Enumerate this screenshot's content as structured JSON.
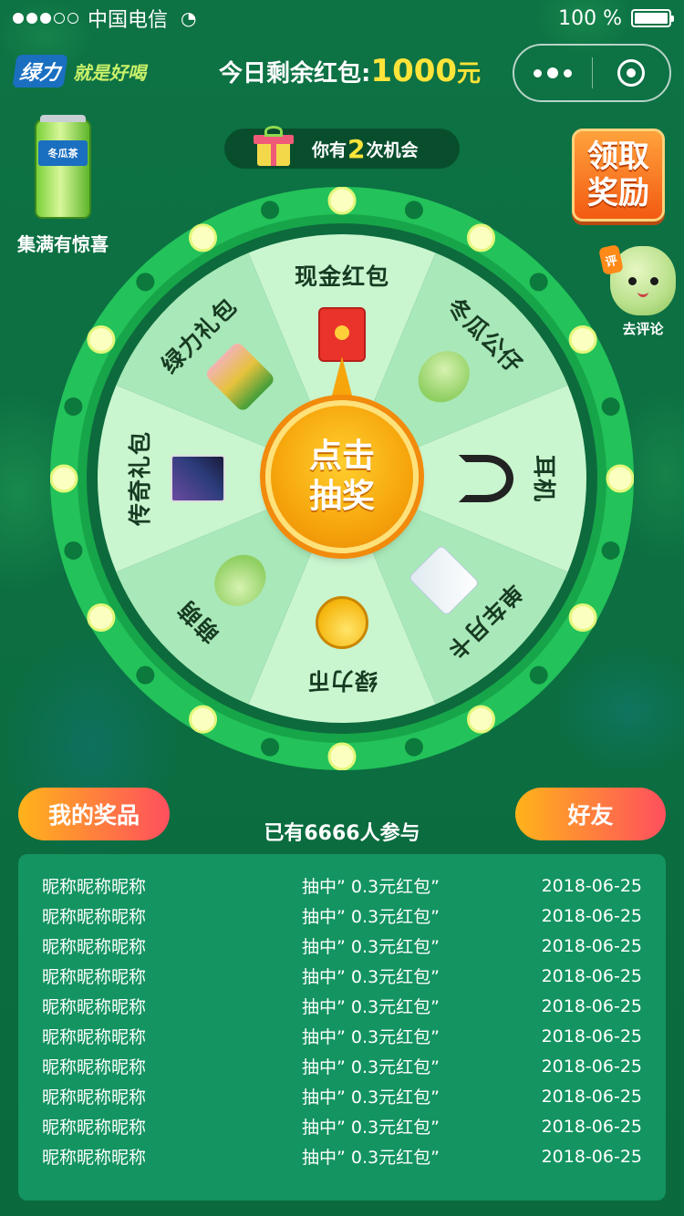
{
  "status_bar": {
    "carrier": "中国电信",
    "battery": "100 %",
    "signal_level": 3,
    "signal_max": 5
  },
  "header": {
    "brand": "绿力",
    "slogan": "就是好喝",
    "remaining_prefix": "今日剩余红包:",
    "remaining_amount": "1000",
    "remaining_unit": "元"
  },
  "can": {
    "label": "冬瓜茶",
    "caption": "集满有惊喜"
  },
  "chance": {
    "prefix": "你有",
    "count": "2",
    "suffix": "次机会"
  },
  "reward_button": {
    "line1": "领取",
    "line2": "奖励"
  },
  "comment": {
    "badge": "评",
    "label": "去评论"
  },
  "wheel": {
    "center_line1": "点击",
    "center_line2": "抽奖",
    "prizes": [
      {
        "label": "现金红包",
        "icon": "red-envelope-icon"
      },
      {
        "label": "冬瓜公仔",
        "icon": "plush-toy-icon"
      },
      {
        "label": "耳机",
        "icon": "headphones-icon"
      },
      {
        "label": "单车月卡",
        "icon": "bike-card-icon"
      },
      {
        "label": "绿力币",
        "icon": "coin-icon"
      },
      {
        "label": "萌萌",
        "icon": "mascot-sticker-icon"
      },
      {
        "label": "传奇礼包",
        "icon": "game-pack-icon"
      },
      {
        "label": "绿力礼包",
        "icon": "gift-pack-icon"
      }
    ],
    "colors": {
      "ring": "#23c25a",
      "inner_border": "#0d6a3c",
      "light_sector": "#c9f5cf",
      "dark_sector": "#a9e8b8",
      "bulb": "#fbffc0"
    }
  },
  "buttons": {
    "my_prizes": "我的奖品",
    "friends": "好友"
  },
  "participants": "已有6666人参与",
  "winners": [
    {
      "name": "昵称昵称昵称",
      "prize": "抽中” 0.3元红包”",
      "date": "2018-06-25"
    },
    {
      "name": "昵称昵称昵称",
      "prize": "抽中” 0.3元红包”",
      "date": "2018-06-25"
    },
    {
      "name": "昵称昵称昵称",
      "prize": "抽中” 0.3元红包”",
      "date": "2018-06-25"
    },
    {
      "name": "昵称昵称昵称",
      "prize": "抽中” 0.3元红包”",
      "date": "2018-06-25"
    },
    {
      "name": "昵称昵称昵称",
      "prize": "抽中” 0.3元红包”",
      "date": "2018-06-25"
    },
    {
      "name": "昵称昵称昵称",
      "prize": "抽中” 0.3元红包”",
      "date": "2018-06-25"
    },
    {
      "name": "昵称昵称昵称",
      "prize": "抽中” 0.3元红包”",
      "date": "2018-06-25"
    },
    {
      "name": "昵称昵称昵称",
      "prize": "抽中” 0.3元红包”",
      "date": "2018-06-25"
    },
    {
      "name": "昵称昵称昵称",
      "prize": "抽中” 0.3元红包”",
      "date": "2018-06-25"
    },
    {
      "name": "昵称昵称昵称",
      "prize": "抽中” 0.3元红包”",
      "date": "2018-06-25"
    }
  ]
}
